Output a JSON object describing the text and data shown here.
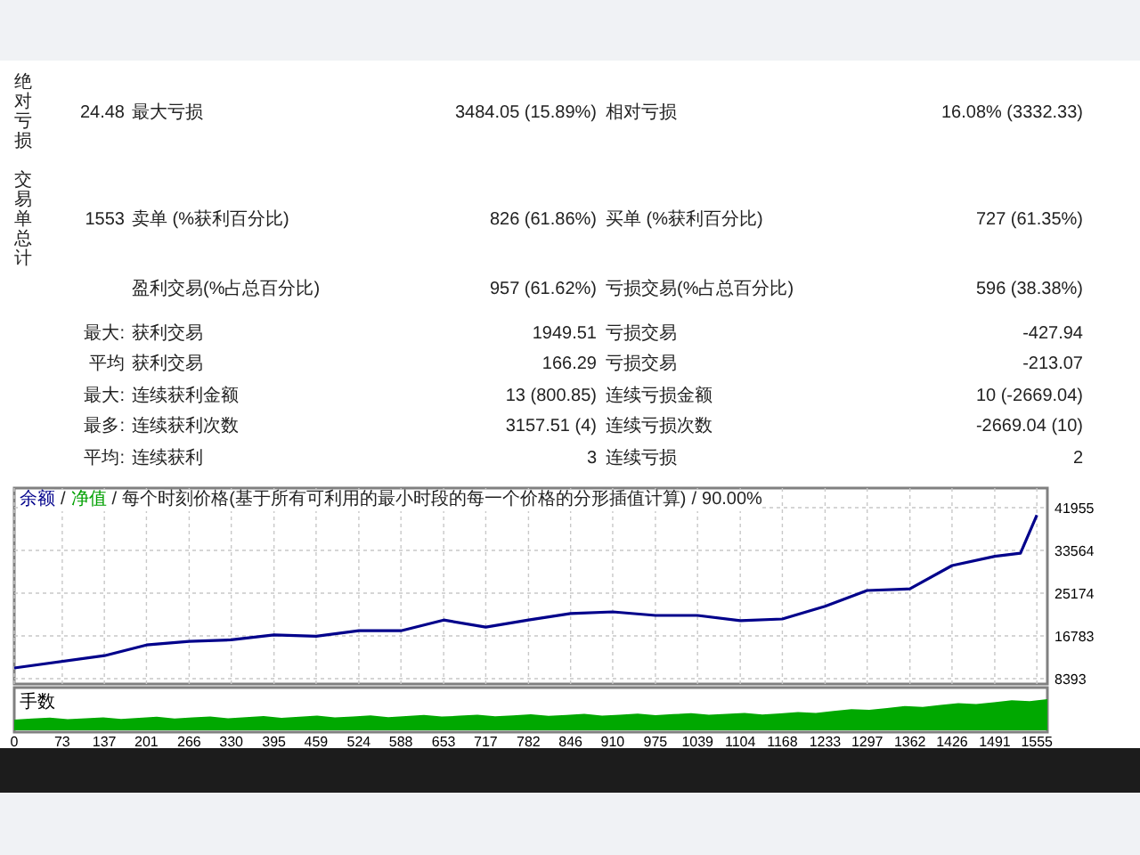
{
  "report": {
    "sections": [
      {
        "side_label": "绝对亏损",
        "value": "24.48",
        "label1": "最大亏损",
        "value1": "3484.05 (15.89%)",
        "label2": "相对亏损",
        "value2": "16.08% (3332.33)"
      },
      {
        "side_label": "交易单总计",
        "value": "1553",
        "label1": "卖单 (%获利百分比)",
        "value1": "826 (61.86%)",
        "label2": "买单 (%获利百分比)",
        "value2": "727 (61.35%)"
      }
    ],
    "rows": [
      {
        "label1": "盈利交易(%占总百分比)",
        "value1": "957 (61.62%)",
        "label2": "亏损交易(%占总百分比)",
        "value2": "596 (38.38%)"
      },
      {
        "prefix": "最大:",
        "label1": "获利交易",
        "value1": "1949.51",
        "label2": "亏损交易",
        "value2": "-427.94"
      },
      {
        "prefix": "平均",
        "label1": "获利交易",
        "value1": "166.29",
        "label2": "亏损交易",
        "value2": "-213.07"
      },
      {
        "prefix": "最大:",
        "label1": "连续获利金额",
        "value1": "13 (800.85)",
        "label2": "连续亏损金额",
        "value2": "10 (-2669.04)"
      },
      {
        "prefix": "最多:",
        "label1": "连续获利次数",
        "value1": "3157.51 (4)",
        "label2": "连续亏损次数",
        "value2": "-2669.04 (10)"
      },
      {
        "prefix": "平均:",
        "label1": "连续获利",
        "value1": "3",
        "label2": "连续亏损",
        "value2": "2"
      }
    ]
  },
  "chart": {
    "title_rest": [
      {
        "kind": "separator",
        "text": "/"
      },
      {
        "kind": "legend",
        "text": "净值",
        "color": "#00a000"
      },
      {
        "kind": "separator",
        "text": "/"
      },
      {
        "kind": "text",
        "text": "每个时刻价格(基于所有可利用的最小时段的每一个价格的分形插值计算)"
      },
      {
        "kind": "separator",
        "text": "/"
      },
      {
        "kind": "text",
        "text": "90.00%"
      }
    ],
    "volume_label": "手数",
    "chart_data": {
      "type": "line",
      "x": [
        0,
        137,
        201,
        266,
        330,
        395,
        459,
        524,
        588,
        653,
        717,
        782,
        846,
        910,
        975,
        1039,
        1104,
        1168,
        1233,
        1297,
        1362,
        1426,
        1491,
        1530,
        1555
      ],
      "series": [
        {
          "name": "余额",
          "color": "#00008b",
          "values": [
            10500,
            12900,
            15000,
            15700,
            16000,
            17000,
            16700,
            17800,
            17800,
            19900,
            18500,
            19900,
            21200,
            21500,
            20800,
            20800,
            19800,
            20100,
            22600,
            25700,
            26000,
            30600,
            32400,
            33000,
            40500
          ]
        }
      ],
      "grid": true,
      "xlim": [
        0,
        1571
      ],
      "ylim": [
        7340,
        45800
      ],
      "xticks": [
        0,
        73,
        137,
        201,
        266,
        330,
        395,
        459,
        524,
        588,
        653,
        717,
        782,
        846,
        910,
        975,
        1039,
        1104,
        1168,
        1233,
        1297,
        1362,
        1426,
        1491,
        1555
      ],
      "yticks": [
        8393,
        16783,
        25174,
        33564,
        41955
      ]
    }
  }
}
